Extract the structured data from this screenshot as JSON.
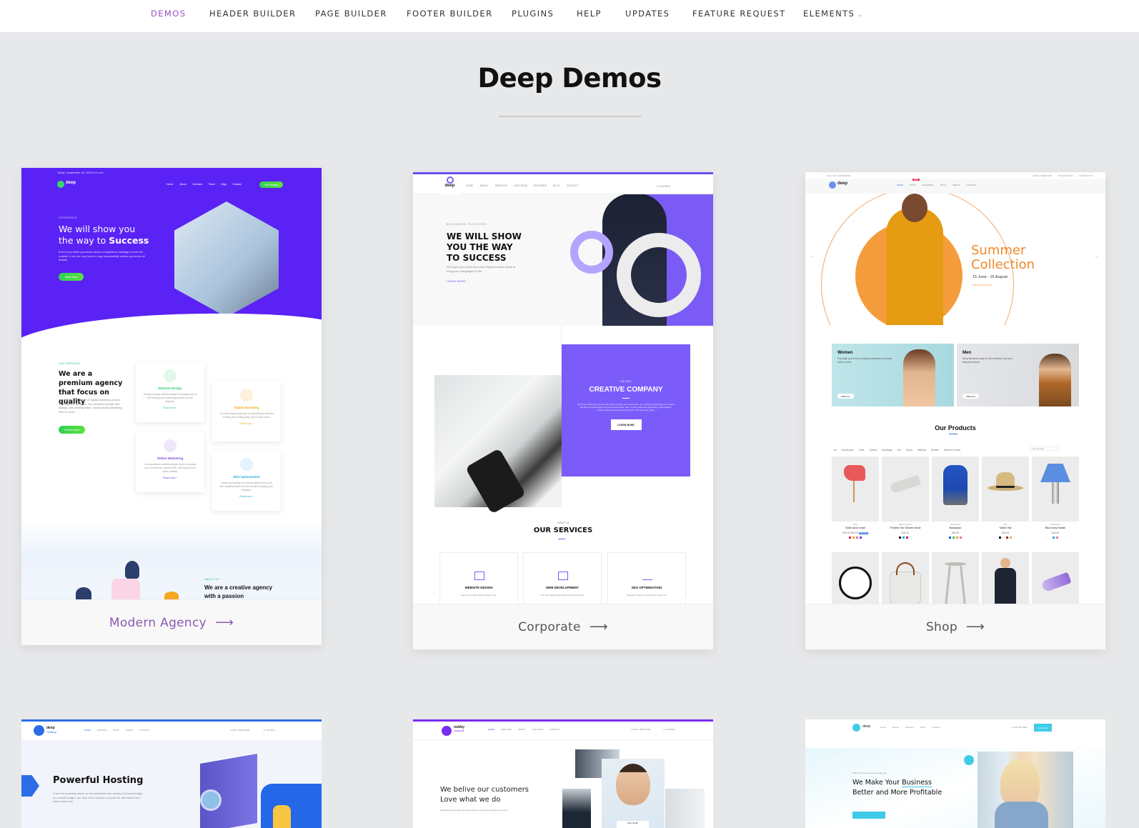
{
  "topnav": {
    "items": [
      {
        "label": "DEMOS",
        "active": true
      },
      {
        "label": "HEADER BUILDER"
      },
      {
        "label": "PAGE BUILDER"
      },
      {
        "label": "FOOTER BUILDER"
      },
      {
        "label": "PLUGINS"
      },
      {
        "label": "HELP"
      },
      {
        "label": "UPDATES"
      },
      {
        "label": "FEATURE REQUEST"
      },
      {
        "label": "ELEMENTS",
        "has_dropdown": true
      }
    ],
    "active_color": "#9b4dca",
    "dropdown_glyph": "⌄"
  },
  "page": {
    "title": "Deep Demos",
    "background": "#e7e8ea"
  },
  "demos": [
    {
      "caption": "Modern Agency",
      "arrow": "⟶",
      "preview": {
        "date": "Today: September 26, 2018 8:14 am",
        "logo": "deep",
        "logo_sub": "Agency",
        "nav": [
          "Home",
          "About",
          "Services",
          "Team",
          "Blog",
          "Contact"
        ],
        "cta": "Get Started",
        "eyebrow": "EXPERIENCE",
        "headline_1": "We will show you",
        "headline_2": "the way to",
        "headline_bold": "Success",
        "body": "Even if you think you know what a competitor's strategy is from the outside, it can be very hard to copy successfully unless you know all details.",
        "hero_button": "Start Now",
        "services_eyebrow": "OUR SERVICES",
        "services_title": "We are a premium agency that focus on quality",
        "services_body": "We offer a wide range of digital marketing & web development services. Our services include web design, web development, social media marketing, SEO & more.",
        "services_button": "All Services",
        "services": [
          {
            "title": "Website Design",
            "desc": "Having a unique website design is important part of the branding and marketing process of your business.",
            "link": "Read more ›",
            "color": "#2ecc71"
          },
          {
            "title": "Digital Branding",
            "desc": "Our new fangled approach to advertising is directed creating and building deep ties for your brand.",
            "link": "Read more ›",
            "color": "#f5a623"
          },
          {
            "title": "Online Marketing",
            "desc": "Our specialized marketing teams work to increase your conversions, repeat traffic, and expand your online visibility.",
            "link": "Read more ›",
            "color": "#7b4bd9"
          },
          {
            "title": "SEO Optimization",
            "desc": "Obtain top rankings for desired search terms and drive qualified leads that are crucial to building your business.",
            "link": "Read more ›",
            "color": "#2aa8e0"
          }
        ],
        "about_eyebrow": "ABOUT US",
        "about_title": "We are a creative agency with a passion"
      }
    },
    {
      "caption": "Corporate",
      "arrow": "⟶",
      "preview": {
        "logo": "deep",
        "logo_sub": "Corporate",
        "nav": [
          "HOME",
          "ABOUT",
          "SERVICES",
          "OUR TEAM",
          "FEATURES",
          "BLOG",
          "CONTACT"
        ],
        "phone": "+1 234 5678",
        "eyebrow": "BUSINESS SUCCESS",
        "headline": "WE WILL SHOW YOU THE WAY TO SUCCESS",
        "body": "We'll give you brand new and original creative ideas to bring your campaigns to life ...",
        "link": "LEARN MORE ›",
        "creative_eyebrow": "WE ARE",
        "creative_title": "CREATIVE COMPANY",
        "creative_body": "We pride ourselves in great work ethic, integrity, and end-results. Our company philosophy is to create the kind of website that most businesses want: easy to find, stylish and appealing, quick loading, mobile responsive and easy to buy from. We are deep group.",
        "creative_button": "LEARN MORE",
        "services_eyebrow": "WHAT IS",
        "services_title": "OUR SERVICES",
        "services": [
          {
            "title": "WEBSITE DESIGN",
            "desc": "Having a unique website design is an"
          },
          {
            "title": "WEB DEVELOPMENT",
            "desc": "Our new fangled approach to Development is"
          },
          {
            "title": "SEO OPTIMIZATION",
            "desc": "Easy2win caters to clients who require an"
          }
        ],
        "accent": "#7b5cfb"
      }
    },
    {
      "caption": "Shop",
      "arrow": "⟶",
      "preview": {
        "top_left": "CALL US: 0 000 0000 00",
        "top_right": [
          "LOGIN / REGISTER",
          "MY ACCOUNT",
          "CONTACT US"
        ],
        "logo": "deep",
        "nav": [
          "HOME",
          "SHOP",
          "ELEMENTS",
          "BLOG",
          "ABOUT",
          "CONTACT"
        ],
        "nav_badge": "NEW",
        "hero_title_1": "Summer",
        "hero_title_2": "Collection",
        "hero_date": "15 June - 15 August",
        "hero_link": "VIEW COLLECTION",
        "banners": [
          {
            "title": "Women",
            "desc": "Find style you've been looking everywhere and wear stuff you love",
            "button": "VIEW ALL"
          },
          {
            "title": "Men",
            "desc": "Shop fabulous range of men's fashion from your favourite brands",
            "button": "VIEW ALL"
          }
        ],
        "products_title": "Our Products",
        "filters": [
          "All",
          "Accessories",
          "Chair",
          "Clothes",
          "Handbags",
          "Hat",
          "Shoes",
          "Watches",
          "Women",
          "Women's Shoes"
        ],
        "sort": "Sort by latest",
        "products": [
          {
            "category": "Chair",
            "name": "Solid wood chair",
            "price": "$99.00 $90.00",
            "badge": "ON SALE",
            "swatches": [
              "#d0213f",
              "#f5a623",
              "#f06bb3",
              "#6f3fd1"
            ]
          },
          {
            "category": "Women's Shoes",
            "name": "Pointed Toe Women shoe",
            "price": "$32.40",
            "swatches": [
              "#111",
              "#2aa8e0",
              "#d0213f",
              "#eee"
            ]
          },
          {
            "category": "Accessories",
            "name": "Backpack",
            "price": "$54.99",
            "swatches": [
              "#1f5fd6",
              "#2ecc71",
              "#f5a623",
              "#f06bb3"
            ]
          },
          {
            "category": "Hat",
            "name": "Safari Hat",
            "price": "$25.04",
            "swatches": [
              "#111",
              "#eee",
              "#7a3b1a",
              "#d4b26a"
            ]
          },
          {
            "category": "Accessories",
            "name": "Blue lamp shade",
            "price": "$44.90",
            "swatches": [
              "#2aa8e0",
              "#f06bb3"
            ]
          }
        ]
      }
    },
    {
      "preview": {
        "logo": "deep",
        "logo_sub": "Hosting",
        "nav": [
          "HOME",
          "HOSTING",
          "BLOG",
          "PAGES",
          "CONTACT"
        ],
        "login": "LOGIN / REGISTER",
        "phone": "+1 234 5678",
        "headline": "Powerful Hosting",
        "body": "From the business owner to the individual who desires full functionality on a small budget, our new cloud solution is powerful, affordable and easier than ever."
      }
    },
    {
      "preview": {
        "logo": "nobby",
        "logo_sub": "corporate",
        "nav": [
          "HOME",
          "SERVICES",
          "ABOUT",
          "OUR TEAM",
          "CONTACT"
        ],
        "login": "LOGIN / REGISTER",
        "phone": "+1 234 5678",
        "headline_1": "We belive our customers",
        "headline_2": "Love what we do",
        "body": "Read all testimonials users said about us and you'll to desire our works.",
        "person": "John Smith"
      }
    },
    {
      "preview": {
        "logo": "deep",
        "nav": [
          "Home",
          "Events",
          "Services",
          "About",
          "Contact"
        ],
        "phone": "+1 234 567 8900",
        "cta": "Contact Us",
        "eyebrow": "Start Your business is not ready yet!",
        "headline_1": "We Make Your",
        "headline_highlight": "Business",
        "headline_2": "Better and More Profitable",
        "accent": "#3fcbe8"
      }
    }
  ]
}
